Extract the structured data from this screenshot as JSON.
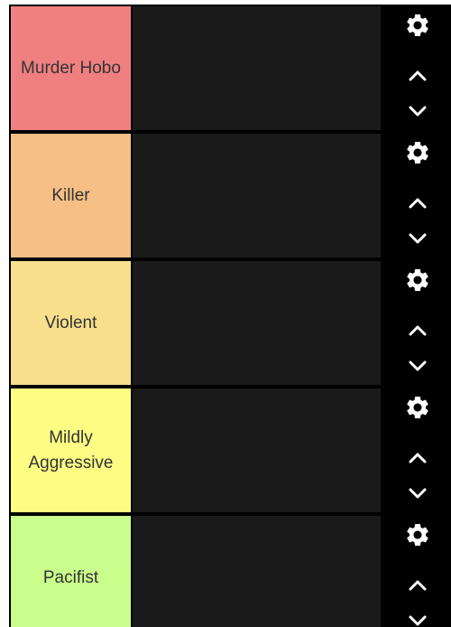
{
  "tiers": [
    {
      "label": "Murder Hobo",
      "color": "#f08080"
    },
    {
      "label": "Killer",
      "color": "#f5bf85"
    },
    {
      "label": "Violent",
      "color": "#f7df8b"
    },
    {
      "label": "Mildly Aggressive",
      "color": "#fdfd84"
    },
    {
      "label": "Pacifist",
      "color": "#c9fd8c"
    }
  ],
  "icons": {
    "settings": "gear-icon",
    "move_up": "chevron-up-icon",
    "move_down": "chevron-down-icon"
  }
}
